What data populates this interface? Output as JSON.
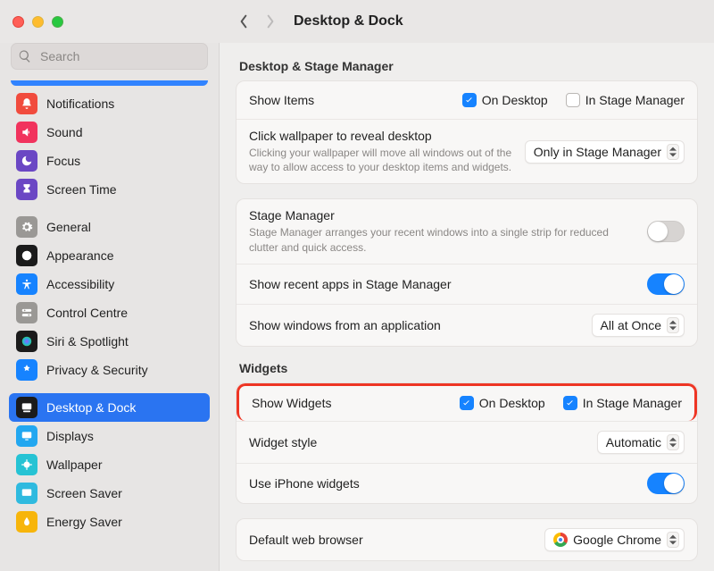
{
  "header": {
    "title": "Desktop & Dock"
  },
  "search": {
    "placeholder": "Search"
  },
  "sidebar": {
    "items": [
      {
        "label": "Notifications",
        "icon": "bell",
        "color": "#f14b3d"
      },
      {
        "label": "Sound",
        "icon": "speaker",
        "color": "#f1335d"
      },
      {
        "label": "Focus",
        "icon": "moon",
        "color": "#6b47c4"
      },
      {
        "label": "Screen Time",
        "icon": "hourglass",
        "color": "#6b47c4"
      },
      {
        "label": "General",
        "icon": "gear",
        "color": "#9a9895"
      },
      {
        "label": "Appearance",
        "icon": "appearance",
        "color": "#1b1b1b"
      },
      {
        "label": "Accessibility",
        "icon": "accessibility",
        "color": "#1683ff"
      },
      {
        "label": "Control Centre",
        "icon": "switches",
        "color": "#9a9895"
      },
      {
        "label": "Siri & Spotlight",
        "icon": "siri",
        "color": "#1b1b1b"
      },
      {
        "label": "Privacy & Security",
        "icon": "hand",
        "color": "#1683ff"
      },
      {
        "label": "Desktop & Dock",
        "icon": "dock",
        "color": "#1b1b1b",
        "selected": true
      },
      {
        "label": "Displays",
        "icon": "displays",
        "color": "#22a7f0"
      },
      {
        "label": "Wallpaper",
        "icon": "wallpaper",
        "color": "#26c3d4"
      },
      {
        "label": "Screen Saver",
        "icon": "screensaver",
        "color": "#2fbadf"
      },
      {
        "label": "Energy Saver",
        "icon": "energy",
        "color": "#f7b50b"
      }
    ]
  },
  "sections": {
    "desktopStage": {
      "title": "Desktop & Stage Manager",
      "showItems": {
        "label": "Show Items",
        "onDesktop": {
          "label": "On Desktop",
          "checked": true
        },
        "inStage": {
          "label": "In Stage Manager",
          "checked": false
        }
      },
      "clickWallpaper": {
        "label": "Click wallpaper to reveal desktop",
        "desc": "Clicking your wallpaper will move all windows out of the way to allow access to your desktop items and widgets.",
        "value": "Only in Stage Manager"
      },
      "stageManager": {
        "label": "Stage Manager",
        "desc": "Stage Manager arranges your recent windows into a single strip for reduced clutter and quick access.",
        "enabled": false
      },
      "showRecent": {
        "label": "Show recent apps in Stage Manager",
        "enabled": true
      },
      "showWindows": {
        "label": "Show windows from an application",
        "value": "All at Once"
      }
    },
    "widgets": {
      "title": "Widgets",
      "showWidgets": {
        "label": "Show Widgets",
        "onDesktop": {
          "label": "On Desktop",
          "checked": true
        },
        "inStage": {
          "label": "In Stage Manager",
          "checked": true
        }
      },
      "widgetStyle": {
        "label": "Widget style",
        "value": "Automatic"
      },
      "useIphone": {
        "label": "Use iPhone widgets",
        "enabled": true
      }
    },
    "browser": {
      "label": "Default web browser",
      "value": "Google Chrome"
    }
  }
}
